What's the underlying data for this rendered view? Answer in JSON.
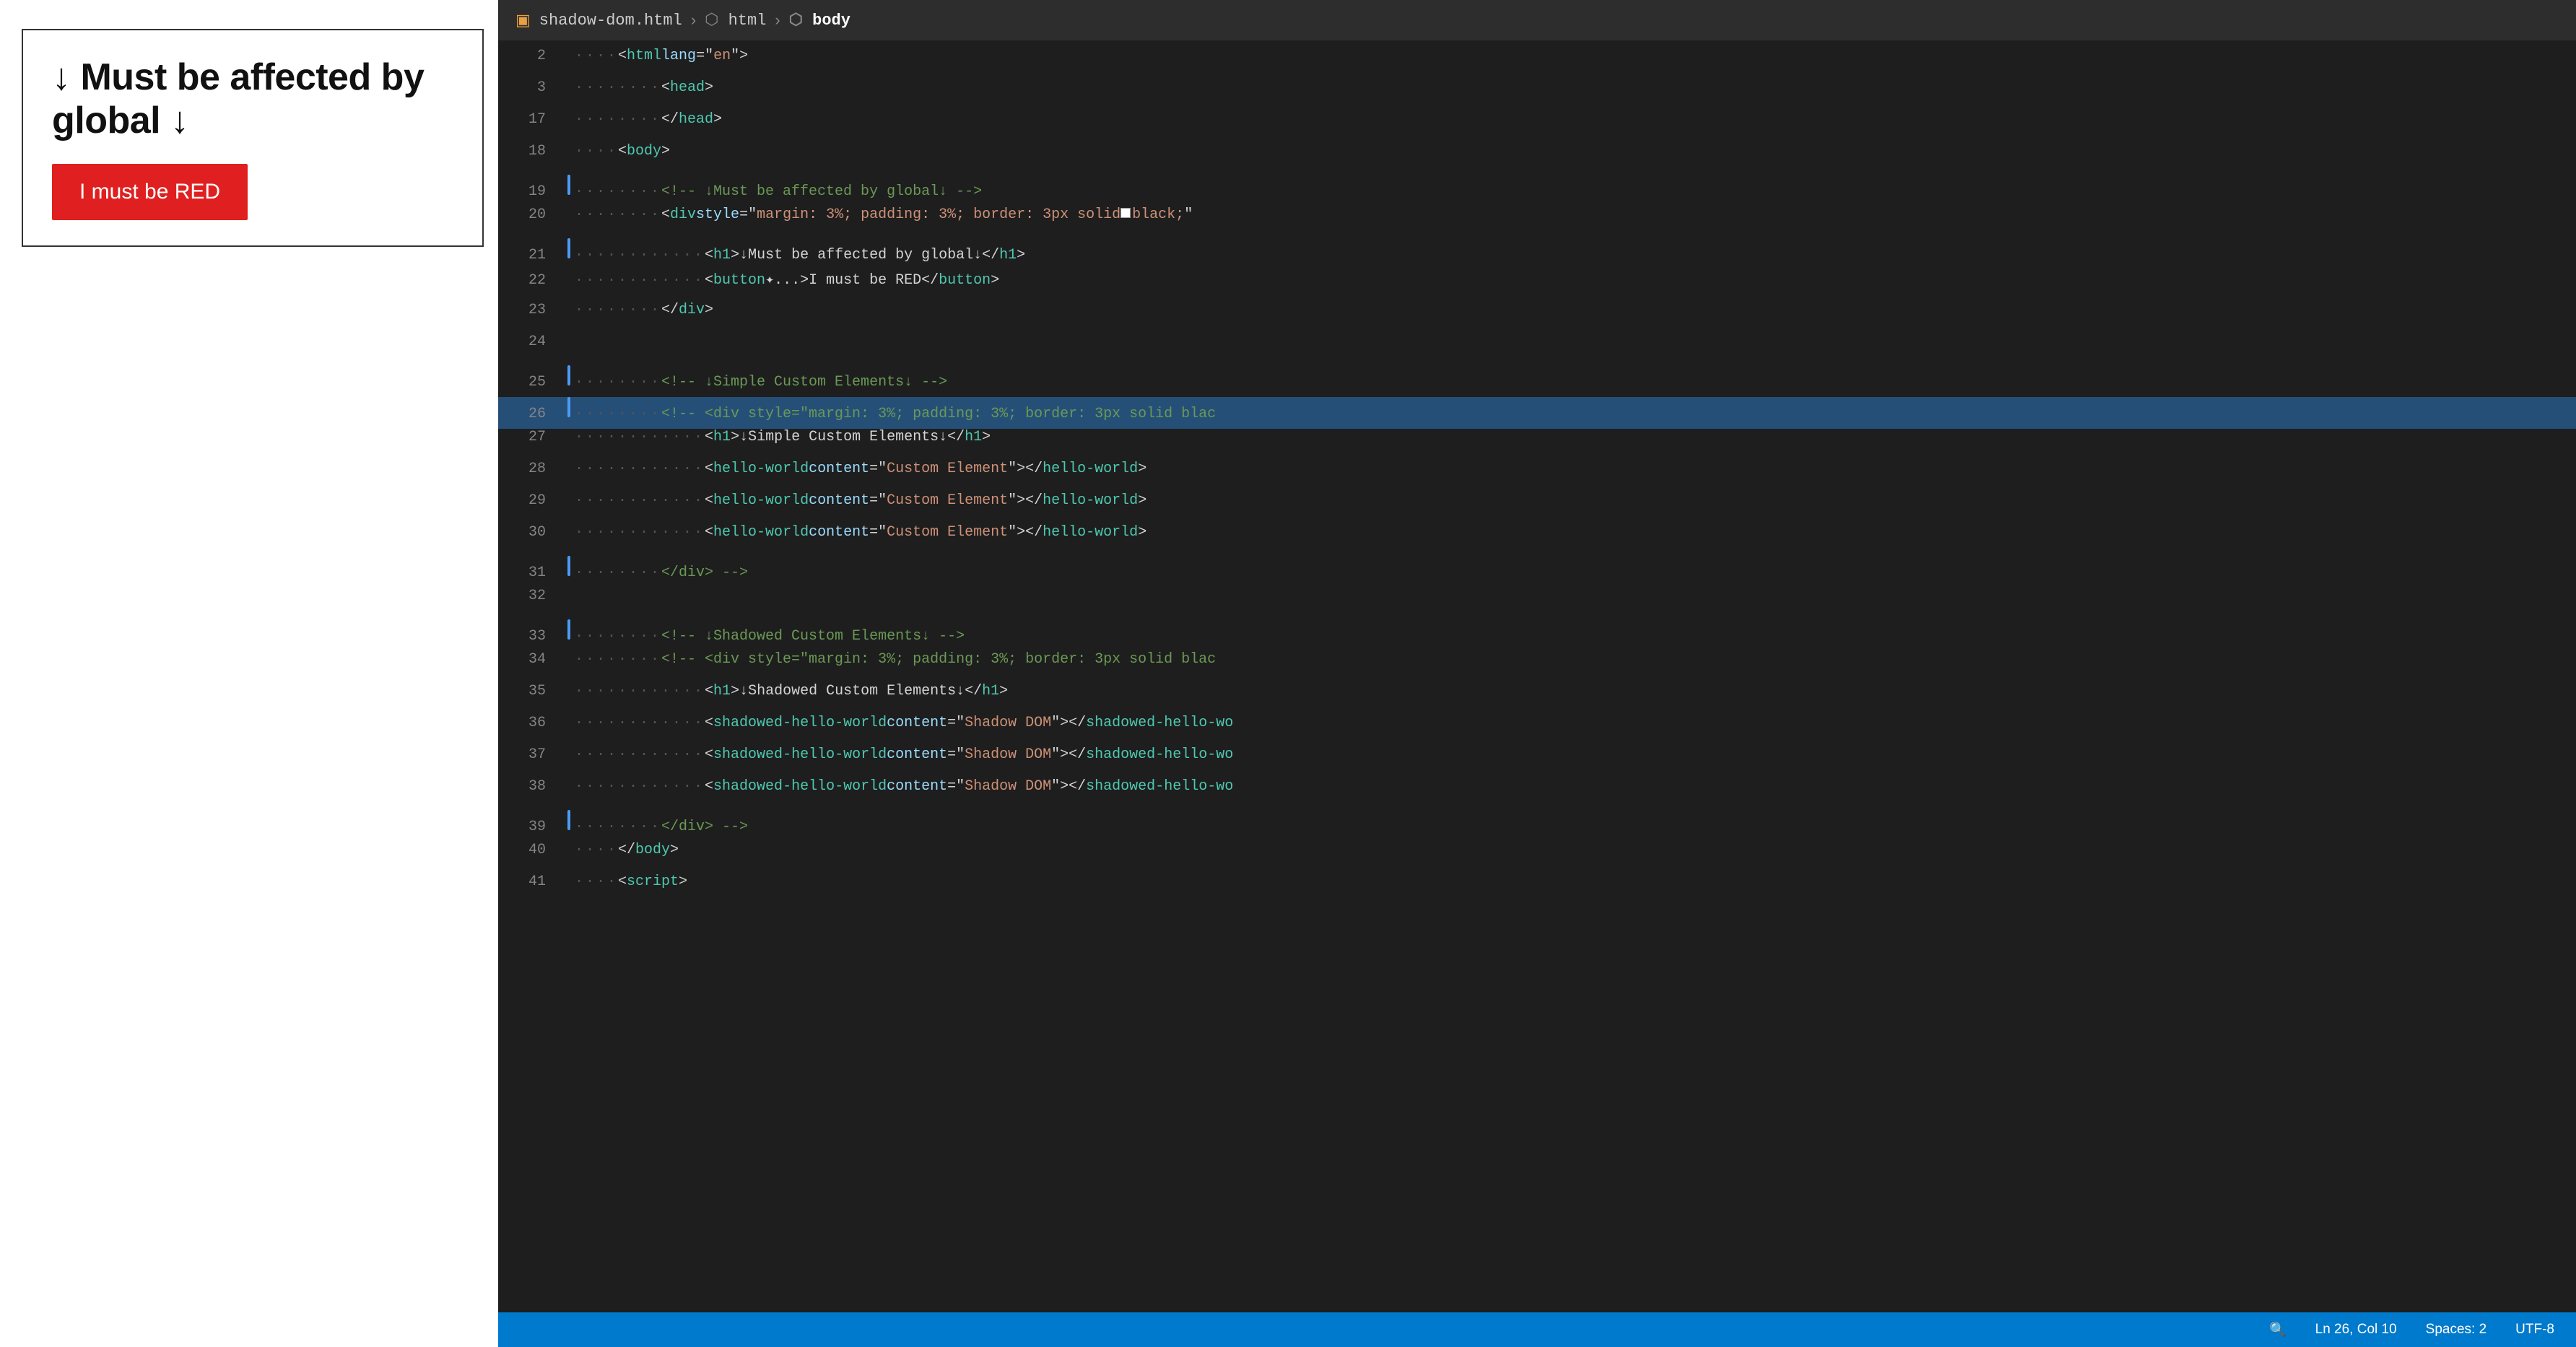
{
  "preview": {
    "title": "↓ Must be affected by global ↓",
    "button_label": "I must be RED",
    "button_color": "#e02020"
  },
  "editor": {
    "breadcrumb": {
      "file": "shadow-dom.html",
      "tag1": "html",
      "tag2": "body"
    },
    "lines": [
      {
        "num": 2,
        "indent": 1,
        "content": "<html lang=\"en\">",
        "gutter": false,
        "highlighted": false
      },
      {
        "num": 3,
        "indent": 2,
        "content": "<head>",
        "gutter": false,
        "highlighted": false
      },
      {
        "num": 17,
        "indent": 2,
        "content": "</head>",
        "gutter": false,
        "highlighted": false
      },
      {
        "num": 18,
        "indent": 2,
        "content": "<body>",
        "gutter": false,
        "highlighted": false
      },
      {
        "num": 19,
        "indent": 3,
        "content": "<!-- ↓Must be affected by global↓ -->",
        "gutter": true,
        "highlighted": false,
        "type": "comment"
      },
      {
        "num": 20,
        "indent": 3,
        "content": "<div style=\"margin: 3%; padding: 3%; border: 3px solid □black;\"",
        "gutter": false,
        "highlighted": false
      },
      {
        "num": 21,
        "indent": 4,
        "content": "<h1>↓Must be affected by global↓</h1>",
        "gutter": true,
        "highlighted": false
      },
      {
        "num": 22,
        "indent": 4,
        "content": "<button ✦...>I must be RED</button>",
        "gutter": false,
        "highlighted": false
      },
      {
        "num": 23,
        "indent": 3,
        "content": "</div>",
        "gutter": false,
        "highlighted": false
      },
      {
        "num": 24,
        "indent": 0,
        "content": "",
        "gutter": false,
        "highlighted": false
      },
      {
        "num": 25,
        "indent": 3,
        "content": "<!-- ↓Simple Custom Elements↓ -->",
        "gutter": true,
        "highlighted": false,
        "type": "comment"
      },
      {
        "num": 26,
        "indent": 3,
        "content": "<!-- <div style=\"margin: 3%; padding: 3%; border: 3px solid blac",
        "gutter": true,
        "highlighted": true,
        "type": "comment"
      },
      {
        "num": 27,
        "indent": 4,
        "content": "<h1>↓Simple Custom Elements↓</h1>",
        "gutter": false,
        "highlighted": false
      },
      {
        "num": 28,
        "indent": 4,
        "content": "<hello-world content=\"Custom Element\"></hello-world>",
        "gutter": false,
        "highlighted": false
      },
      {
        "num": 29,
        "indent": 4,
        "content": "<hello-world content=\"Custom Element\"></hello-world>",
        "gutter": false,
        "highlighted": false
      },
      {
        "num": 30,
        "indent": 4,
        "content": "<hello-world content=\"Custom Element\"></hello-world>",
        "gutter": false,
        "highlighted": false
      },
      {
        "num": 31,
        "indent": 3,
        "content": "</div> -->",
        "gutter": true,
        "highlighted": false
      },
      {
        "num": 32,
        "indent": 0,
        "content": "",
        "gutter": false,
        "highlighted": false
      },
      {
        "num": 33,
        "indent": 3,
        "content": "<!-- ↓Shadowed Custom Elements↓ -->",
        "gutter": true,
        "highlighted": false,
        "type": "comment"
      },
      {
        "num": 34,
        "indent": 3,
        "content": "<!-- <div style=\"margin: 3%; padding: 3%; border: 3px solid blac",
        "gutter": false,
        "highlighted": false,
        "type": "comment"
      },
      {
        "num": 35,
        "indent": 4,
        "content": "<h1>↓Shadowed Custom Elements↓</h1>",
        "gutter": false,
        "highlighted": false
      },
      {
        "num": 36,
        "indent": 4,
        "content": "<shadowed-hello-world content=\"Shadow DOM\"></shadowed-hello-wo",
        "gutter": false,
        "highlighted": false
      },
      {
        "num": 37,
        "indent": 4,
        "content": "<shadowed-hello-world content=\"Shadow DOM\"></shadowed-hello-wo",
        "gutter": false,
        "highlighted": false
      },
      {
        "num": 38,
        "indent": 4,
        "content": "<shadowed-hello-world content=\"Shadow DOM\"></shadowed-hello-wo",
        "gutter": false,
        "highlighted": false
      },
      {
        "num": 39,
        "indent": 3,
        "content": "</div> -->",
        "gutter": true,
        "highlighted": false
      },
      {
        "num": 40,
        "indent": 2,
        "content": "</body>",
        "gutter": false,
        "highlighted": false
      },
      {
        "num": 41,
        "indent": 2,
        "content": "<script>",
        "gutter": false,
        "highlighted": false
      }
    ]
  },
  "statusbar": {
    "position": "Ln 26, Col 10",
    "spaces": "Spaces: 2",
    "encoding": "UTF-8",
    "magnifier_icon": "🔍"
  }
}
